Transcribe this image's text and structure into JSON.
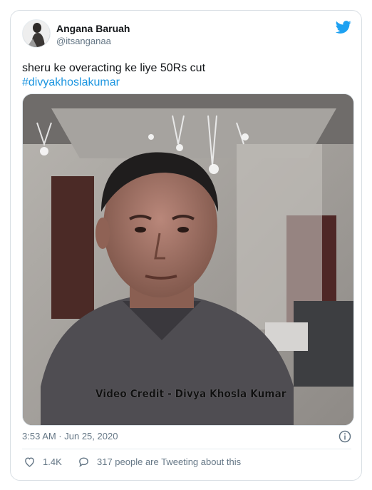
{
  "user": {
    "name": "Angana Baruah",
    "handle": "@itsanganaa"
  },
  "tweet": {
    "text": "sheru ke overacting ke liye 50Rs cut",
    "hashtag": "#divyakhoslakumar",
    "timestamp": "3:53 AM · Jun 25, 2020"
  },
  "media": {
    "video_credit": "Video Credit - Divya Khosla Kumar"
  },
  "actions": {
    "likes": "1.4K",
    "conversation": "317 people are Tweeting about this"
  },
  "colors": {
    "twitter_blue": "#1da1f2",
    "hashtag": "#1b95e0",
    "muted_text": "#657786"
  },
  "icons": [
    "twitter-bird-icon",
    "info-icon",
    "heart-icon",
    "reply-icon"
  ]
}
